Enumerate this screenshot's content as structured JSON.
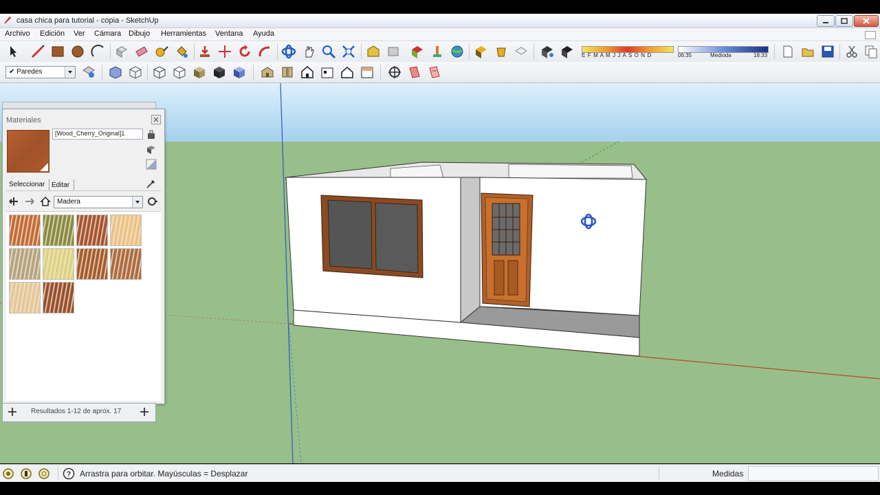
{
  "window": {
    "title": "casa chica para tutorial - copia - SketchUp"
  },
  "menu": [
    "Archivo",
    "Edición",
    "Ver",
    "Cámara",
    "Dibujo",
    "Herramientas",
    "Ventana",
    "Ayuda"
  ],
  "toolbar": {
    "months_label": "E F M A M J J A S O N D",
    "time_start": "06:35",
    "time_mid": "Medioda",
    "time_end": "18:33",
    "layer_value": "Paredes"
  },
  "materials": {
    "panel_title": "Materiales",
    "material_name": "[Wood_Cherry_Original]1",
    "tab_select": "Seleccionar",
    "tab_edit": "Editar",
    "category": "Madera",
    "swatches": [
      "#c86a2f",
      "#8a8a3a",
      "#a9522a",
      "#efc27d",
      "#b8a47a",
      "#e0d27a",
      "#a85a26",
      "#b06a3a",
      "#e8c792",
      "#9a4f25"
    ],
    "results": "Resultados 1-12 de aprox. 17"
  },
  "status": {
    "hint": "Arrastra para orbitar. Mayúsculas = Desplazar",
    "measure_label": "Medidas"
  },
  "colors": {
    "sky": "#a8d3ef",
    "ground": "#98bf8a",
    "wood": "#a9522a"
  }
}
